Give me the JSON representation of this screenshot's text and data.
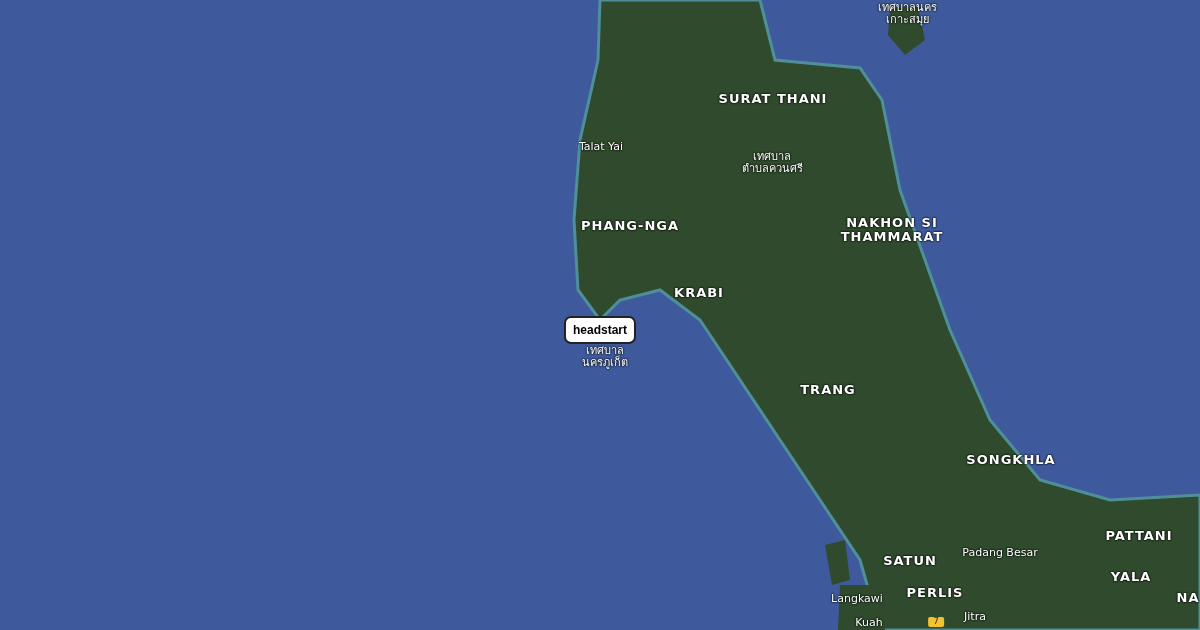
{
  "map": {
    "labels": [
      {
        "kind": "town",
        "text": "เทศบาลนคร\nเกาะสมุย"
      },
      {
        "kind": "region",
        "text": "SURAT THANI"
      },
      {
        "kind": "town",
        "text": "Talat Yai"
      },
      {
        "kind": "town",
        "text": "เทศบาล\nตำบลควนศรี"
      },
      {
        "kind": "region",
        "text": "PHANG-NGA"
      },
      {
        "kind": "region",
        "text": "NAKHON SI\nTHAMMARAT"
      },
      {
        "kind": "region",
        "text": "KRABI"
      },
      {
        "kind": "town",
        "text": "เทศบาล\nนครภูเก็ต"
      },
      {
        "kind": "region",
        "text": "TRANG"
      },
      {
        "kind": "region",
        "text": "SONGKHLA"
      },
      {
        "kind": "region",
        "text": "PATTANI"
      },
      {
        "kind": "town",
        "text": "Padang Besar"
      },
      {
        "kind": "region",
        "text": "SATUN"
      },
      {
        "kind": "region",
        "text": "YALA"
      },
      {
        "kind": "town",
        "text": "Langkawi"
      },
      {
        "kind": "region",
        "text": "PERLIS"
      },
      {
        "kind": "region",
        "text": "NA"
      },
      {
        "kind": "town",
        "text": "Kuah"
      },
      {
        "kind": "shield",
        "text": "7"
      },
      {
        "kind": "town",
        "text": "Jitra"
      }
    ],
    "marker": {
      "label": "headstart"
    }
  }
}
